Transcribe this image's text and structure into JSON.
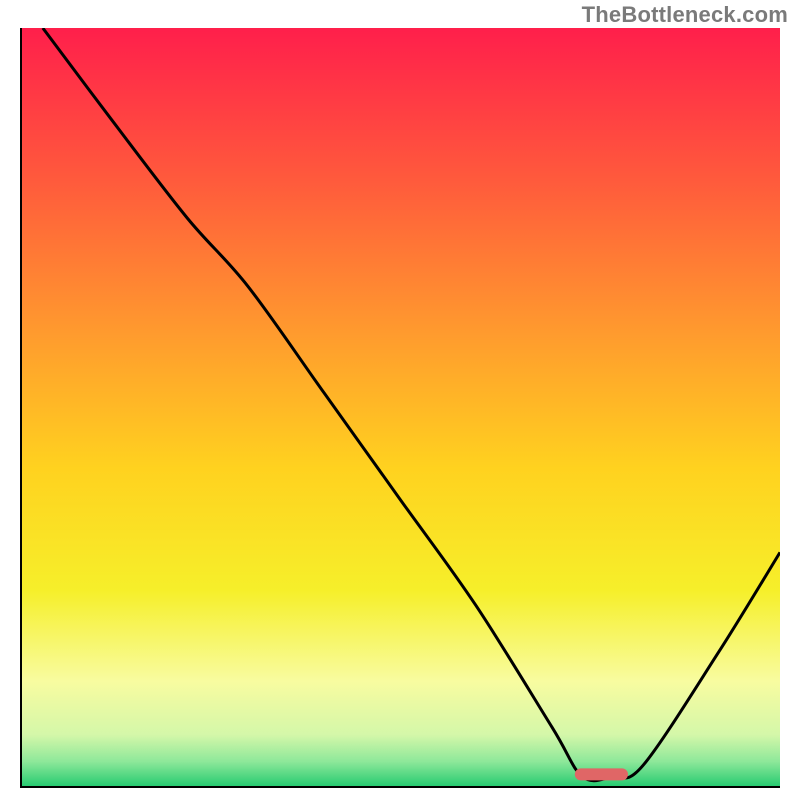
{
  "watermark": "TheBottleneck.com",
  "chart_data": {
    "type": "line",
    "title": "",
    "xlabel": "",
    "ylabel": "",
    "xlim": [
      0,
      100
    ],
    "ylim": [
      0,
      100
    ],
    "grid": false,
    "series": [
      {
        "name": "curve",
        "x": [
          3,
          12,
          22,
          30,
          40,
          50,
          60,
          70,
          74,
          78,
          82,
          92,
          100
        ],
        "y": [
          100,
          88,
          75,
          66,
          52,
          38,
          24,
          8,
          1.5,
          1.5,
          3,
          18,
          31
        ]
      }
    ],
    "marker": {
      "name": "optimal-region",
      "x_start": 73,
      "x_end": 80,
      "y": 1.8,
      "color": "#e06666"
    },
    "background": {
      "type": "vertical-gradient",
      "stops": [
        {
          "offset": 0.0,
          "color": "#ff1f4b"
        },
        {
          "offset": 0.2,
          "color": "#ff5a3c"
        },
        {
          "offset": 0.4,
          "color": "#ff9a2e"
        },
        {
          "offset": 0.58,
          "color": "#ffd21f"
        },
        {
          "offset": 0.74,
          "color": "#f6ef2a"
        },
        {
          "offset": 0.86,
          "color": "#f8fca0"
        },
        {
          "offset": 0.93,
          "color": "#d4f7a9"
        },
        {
          "offset": 0.965,
          "color": "#8ee89a"
        },
        {
          "offset": 1.0,
          "color": "#20c96e"
        }
      ]
    },
    "axis_color": "#000000",
    "curve_color": "#000000",
    "curve_width": 3
  }
}
